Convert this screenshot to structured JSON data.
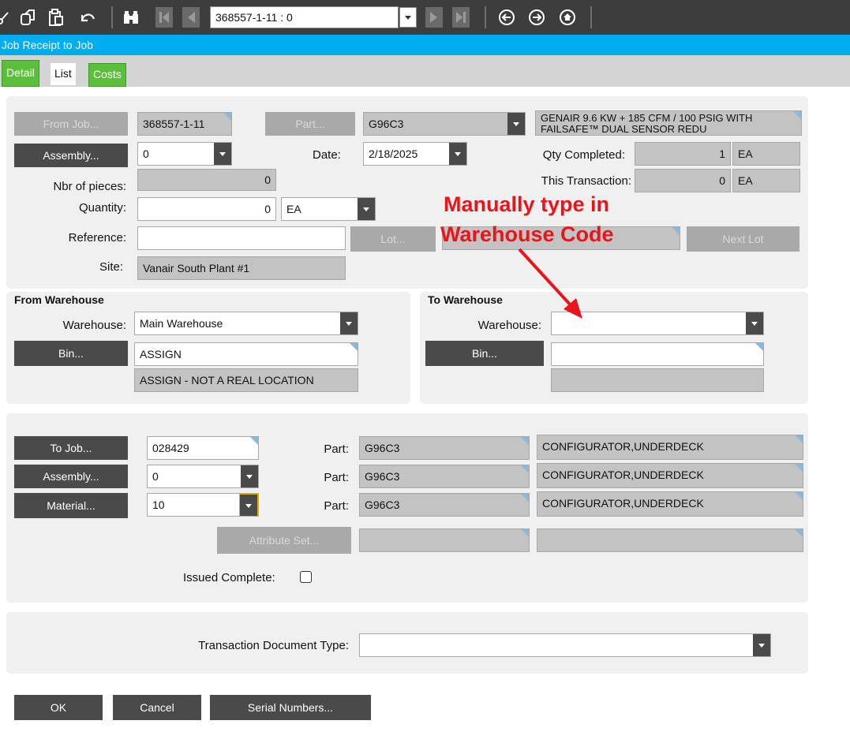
{
  "toolbar": {
    "record_nav_value": "368557-1-11 : 0",
    "icons": [
      "scissors-icon",
      "copy-icon",
      "paste-icon",
      "undo-icon",
      "binoculars-icon",
      "first-record-icon",
      "previous-record-icon",
      "next-record-icon",
      "last-record-icon",
      "back-icon",
      "forward-icon",
      "home-icon"
    ]
  },
  "title": "Job Receipt to Job",
  "tabs": {
    "detail": "Detail",
    "list": "List",
    "costs": "Costs"
  },
  "header": {
    "from_job_button": "From Job...",
    "from_job_value": "368557-1-11",
    "part_button": "Part...",
    "part_value": "G96C3",
    "part_description": "GENAIR 9.6 KW + 185 CFM / 100 PSIG WITH FAILSAFE™ DUAL SENSOR REDU",
    "assembly_button": "Assembly...",
    "assembly_value": "0",
    "date_label": "Date:",
    "date_value": "2/18/2025",
    "qty_completed_label": "Qty Completed:",
    "qty_completed_value": "1",
    "qty_completed_uom": "EA",
    "this_transaction_label": "This Transaction:",
    "this_transaction_value": "0",
    "this_transaction_uom": "EA",
    "nbr_pieces_label": "Nbr of pieces:",
    "nbr_pieces_value": "0",
    "quantity_label": "Quantity:",
    "quantity_value": "0",
    "quantity_uom": "EA",
    "reference_label": "Reference:",
    "reference_value": "",
    "lot_button": "Lot...",
    "lot_value": "",
    "next_lot_button": "Next Lot",
    "site_label": "Site:",
    "site_value": "Vanair South Plant #1"
  },
  "annotation": {
    "line1": "Manually type in",
    "line2": "Warehouse Code",
    "color": "#e8151b"
  },
  "from_warehouse": {
    "section_title": "From Warehouse",
    "warehouse_label": "Warehouse:",
    "warehouse_value": "Main Warehouse",
    "bin_button": "Bin...",
    "bin_value": "ASSIGN",
    "bin_description": "ASSIGN - NOT A REAL LOCATION"
  },
  "to_warehouse": {
    "section_title": "To Warehouse",
    "warehouse_label": "Warehouse:",
    "warehouse_value": "",
    "bin_button": "Bin...",
    "bin_value": "",
    "bin_description": ""
  },
  "to_job": {
    "to_job_button": "To Job...",
    "to_job_value": "028429",
    "assembly_button": "Assembly...",
    "assembly_value": "0",
    "material_button": "Material...",
    "material_value": "10",
    "part_label": "Part:",
    "part_value_1": "G96C3",
    "part_value_2": "G96C3",
    "part_value_3": "G96C3",
    "part_desc_1": "CONFIGURATOR,UNDERDECK",
    "part_desc_2": "CONFIGURATOR,UNDERDECK",
    "part_desc_3": "CONFIGURATOR,UNDERDECK",
    "attribute_set_button": "Attribute Set...",
    "issued_complete_label": "Issued Complete:"
  },
  "transaction": {
    "doc_type_label": "Transaction Document Type:",
    "doc_type_value": ""
  },
  "footer": {
    "ok": "OK",
    "cancel": "Cancel",
    "serial_numbers": "Serial Numbers..."
  },
  "colors": {
    "toolbar": "#3d3d3d",
    "title_bar": "#00aeef",
    "active_tab": "#5cbf3b",
    "button": "#4a4a4a",
    "readonly_field": "#c3c3c3",
    "panel": "#f0f0f0"
  }
}
